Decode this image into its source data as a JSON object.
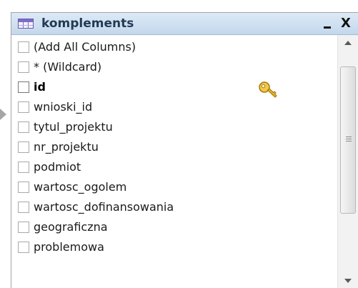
{
  "window": {
    "title": "komplements",
    "minimize_label": "_",
    "close_label": "X"
  },
  "columns": [
    {
      "label": "(Add All Columns)",
      "checked": false,
      "bold": false,
      "key": false
    },
    {
      "label": "* (Wildcard)",
      "checked": false,
      "bold": false,
      "key": false
    },
    {
      "label": "id",
      "checked": false,
      "bold": true,
      "key": true
    },
    {
      "label": "wnioski_id",
      "checked": false,
      "bold": false,
      "key": false
    },
    {
      "label": "tytul_projektu",
      "checked": false,
      "bold": false,
      "key": false
    },
    {
      "label": "nr_projektu",
      "checked": false,
      "bold": false,
      "key": false
    },
    {
      "label": "podmiot",
      "checked": false,
      "bold": false,
      "key": false
    },
    {
      "label": "wartosc_ogolem",
      "checked": false,
      "bold": false,
      "key": false
    },
    {
      "label": "wartosc_dofinansowania",
      "checked": false,
      "bold": false,
      "key": false
    },
    {
      "label": "geograficzna",
      "checked": false,
      "bold": false,
      "key": false
    },
    {
      "label": "problemowa",
      "checked": false,
      "bold": false,
      "key": false
    }
  ],
  "icons": {
    "table": "table-icon",
    "primary_key": "key-icon",
    "row_pointer": "row-pointer-icon"
  },
  "colors": {
    "titlebar": "#cfe0f1",
    "title_text": "#243a54",
    "key_gold": "#e8b923"
  }
}
